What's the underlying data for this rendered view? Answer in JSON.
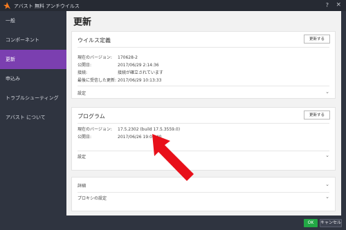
{
  "window": {
    "title": "アバスト 無料 アンチウイルス",
    "help": "?",
    "close": "×"
  },
  "sidebar": {
    "items": [
      {
        "label": "一般"
      },
      {
        "label": "コンポーネント"
      },
      {
        "label": "更新",
        "active": true
      },
      {
        "label": "申込み"
      },
      {
        "label": "トラブルシューティング"
      },
      {
        "label": "アバスト について"
      }
    ]
  },
  "main": {
    "title": "更新",
    "virus": {
      "title": "ウイルス定義",
      "update_button": "更新する",
      "rows": [
        {
          "k": "現在のバージョン:",
          "v": "170628-2"
        },
        {
          "k": "公開日:",
          "v": "2017/06/29 2:14:36"
        },
        {
          "k": "接続:",
          "v": "接続が確立されています"
        },
        {
          "k": "最後に受信した更新:",
          "v": "2017/06/29 10:13:33"
        }
      ],
      "settings": "設定"
    },
    "program": {
      "title": "プログラム",
      "update_button": "更新する",
      "rows": [
        {
          "k": "現在のバージョン:",
          "v": "17.5.2302 (build 17.5.3559.0)"
        },
        {
          "k": "公開日:",
          "v": "2017/06/26 19:04:40"
        }
      ],
      "settings": "設定"
    },
    "extra": {
      "details": "詳細",
      "proxy": "プロキシの設定"
    }
  },
  "footer": {
    "ok": "OK",
    "cancel": "キャンセル"
  },
  "colors": {
    "accent": "#7b3fb0",
    "ok": "#22a845",
    "arrow": "#e8101a",
    "logo": "#f47a20"
  }
}
